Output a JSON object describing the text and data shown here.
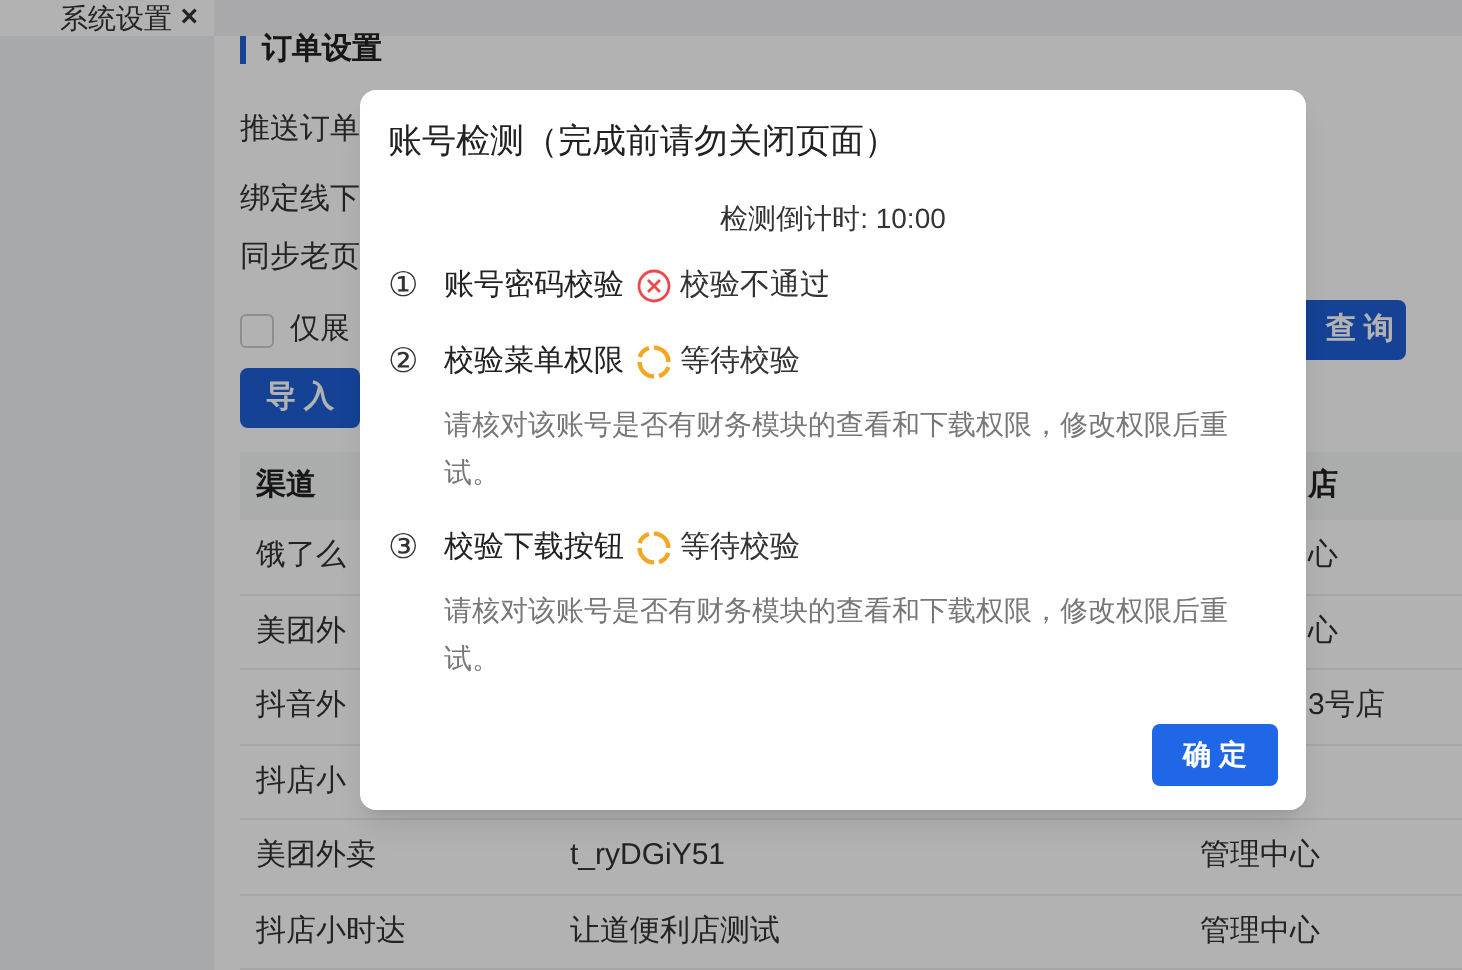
{
  "tab": {
    "label": "系统设置",
    "close": "×"
  },
  "section": {
    "title": "订单设置"
  },
  "settings": [
    {
      "label": "推送订单"
    },
    {
      "label": "绑定线下"
    },
    {
      "label": "同步老页"
    }
  ],
  "filter": {
    "label": "仅展",
    "checked": false
  },
  "buttons": {
    "query": "查 询",
    "import": "导 入"
  },
  "table": {
    "columns": [
      "渠道",
      "",
      "店"
    ],
    "rows": [
      [
        "饿了么",
        "",
        "心"
      ],
      [
        "美团外",
        "",
        "心"
      ],
      [
        "抖音外",
        "",
        "3号店"
      ],
      [
        "抖店小",
        "",
        ""
      ],
      [
        "美团外卖",
        "t_ryDGiY51",
        "管理中心"
      ],
      [
        "抖店小时达",
        "让道便利店测试",
        "管理中心"
      ]
    ]
  },
  "dialog": {
    "title": "账号检测（完成前请勿关闭页面）",
    "countdown": "检测倒计时: 10:00",
    "steps": [
      {
        "number": "①",
        "label": "账号密码校验",
        "status": {
          "kind": "failed",
          "text": "校验不通过"
        }
      },
      {
        "number": "②",
        "label": "校验菜单权限",
        "status": {
          "kind": "pending",
          "text": "等待校验"
        },
        "description": "请核对该账号是否有财务模块的查看和下载权限，修改权限后重试。"
      },
      {
        "number": "③",
        "label": "校验下载按钮",
        "status": {
          "kind": "pending",
          "text": "等待校验"
        },
        "description": "请核对该账号是否有财务模块的查看和下载权限，修改权限后重试。"
      }
    ],
    "confirm": "确 定"
  }
}
